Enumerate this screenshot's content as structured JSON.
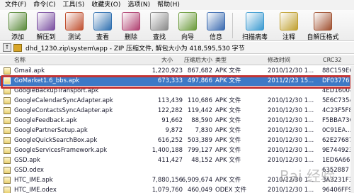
{
  "menu": [
    "文件(F)",
    "命令(C)",
    "工具(S)",
    "收藏夹(O)",
    "选项(N)",
    "帮助(H)"
  ],
  "toolbar": [
    {
      "label": "添加",
      "icon": "add-archive-icon",
      "color": "#5a8a3a"
    },
    {
      "label": "解压到",
      "icon": "extract-to-icon",
      "color": "#7a4fa0"
    },
    {
      "label": "测试",
      "icon": "test-icon",
      "color": "#c05030"
    },
    {
      "label": "查看",
      "icon": "view-icon",
      "color": "#3070b0"
    },
    {
      "label": "删除",
      "icon": "delete-icon",
      "color": "#b04070"
    },
    {
      "label": "查找",
      "icon": "find-icon",
      "color": "#8a8a8a"
    },
    {
      "label": "向导",
      "icon": "wizard-icon",
      "color": "#6a9a3a"
    },
    {
      "label": "信息",
      "icon": "info-icon",
      "color": "#3a6ab0"
    },
    {
      "label": "扫描病毒",
      "icon": "scan-virus-icon",
      "color": "#3a9ad0"
    },
    {
      "label": "注释",
      "icon": "comment-icon",
      "color": "#c0a030"
    },
    {
      "label": "自解压格式",
      "icon": "sfx-icon",
      "color": "#a05030"
    }
  ],
  "address": {
    "path": "dhd_1230.zip\\system\\app - ZIP 压缩文件, 解包大小为 418,595,530 字节"
  },
  "columns": {
    "name": "名称",
    "size": "大小",
    "packed": "压缩后大小",
    "type": "类型",
    "modified": "修改时间",
    "crc": "CRC32"
  },
  "files": [
    {
      "name": "Gmail.apk",
      "size": "1,220,923",
      "packed": "867,682",
      "type": "APK 文件",
      "modified": "2010/12/30 1...",
      "crc": "88C159E6",
      "selected": false
    },
    {
      "name": "GoMarket1.6_bbs.apk",
      "size": "673,333",
      "packed": "497,866",
      "type": "APK 文件",
      "modified": "2011/2/23 15...",
      "crc": "DF037762",
      "selected": true
    },
    {
      "name": "GoogleBackupTransport.apk",
      "size": "",
      "packed": "",
      "type": "",
      "modified": "",
      "crc": "4ED16004",
      "selected": false
    },
    {
      "name": "GoogleCalendarSyncAdapter.apk",
      "size": "113,439",
      "packed": "110,686",
      "type": "APK 文件",
      "modified": "2010/12/30 1...",
      "crc": "5E6C7354",
      "selected": false
    },
    {
      "name": "GoogleContactsSyncAdapter.apk",
      "size": "122,282",
      "packed": "119,442",
      "type": "APK 文件",
      "modified": "2010/12/30 1...",
      "crc": "4C23F5F8",
      "selected": false
    },
    {
      "name": "GoogleFeedback.apk",
      "size": "91,662",
      "packed": "88,590",
      "type": "APK 文件",
      "modified": "2010/12/30 1...",
      "crc": "F5BBA73C",
      "selected": false
    },
    {
      "name": "GooglePartnerSetup.apk",
      "size": "9,872",
      "packed": "7,830",
      "type": "APK 文件",
      "modified": "2010/12/30 1...",
      "crc": "0C91EA...",
      "selected": false
    },
    {
      "name": "GoogleQuickSearchBox.apk",
      "size": "616,252",
      "packed": "503,389",
      "type": "APK 文件",
      "modified": "2010/12/30 1...",
      "crc": "62E27687",
      "selected": false
    },
    {
      "name": "GoogleServicesFramework.apk",
      "size": "1,400,188",
      "packed": "799,127",
      "type": "APK 文件",
      "modified": "2010/12/30 1...",
      "crc": "9E744923",
      "selected": false
    },
    {
      "name": "GSD.apk",
      "size": "411,427",
      "packed": "48,152",
      "type": "APK 文件",
      "modified": "2010/12/30 1...",
      "crc": "1ED6A66E",
      "selected": false
    },
    {
      "name": "GSD.odex",
      "size": "",
      "packed": "",
      "type": "",
      "modified": "",
      "crc": "6352887",
      "selected": false
    },
    {
      "name": "HTC_IME.apk",
      "size": "7,880,156",
      "packed": "6,909,674",
      "type": "APK 文件",
      "modified": "2010/12/30 1...",
      "crc": "3A3231F3",
      "selected": false
    },
    {
      "name": "HTC_IME.odex",
      "size": "1,079,760",
      "packed": "460,049",
      "type": "ODEX 文件",
      "modified": "2010/12/30 1...",
      "crc": "96406FF9",
      "selected": false
    }
  ],
  "watermark": "Bai 经验"
}
